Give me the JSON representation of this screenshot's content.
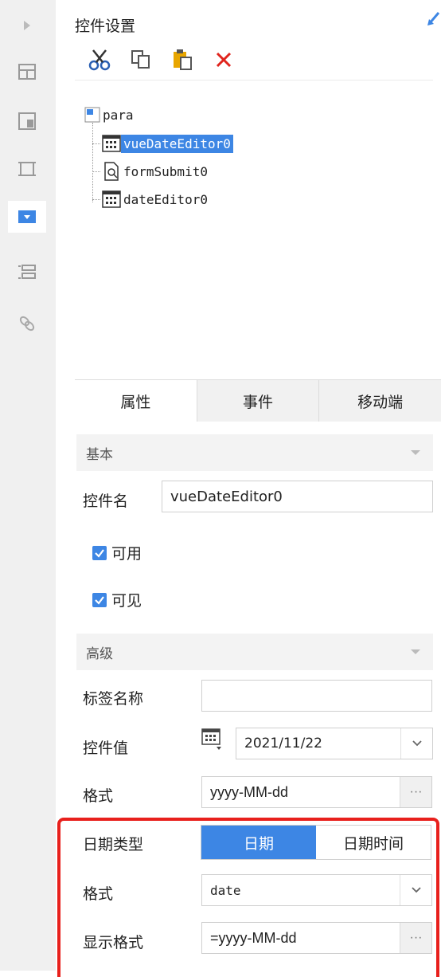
{
  "panel": {
    "title": "控件设置"
  },
  "toolbar": {
    "icons": [
      "cut-icon",
      "copy-icon",
      "paste-icon",
      "delete-icon"
    ]
  },
  "tree": {
    "root": "para",
    "children": [
      "vueDateEditor0",
      "formSubmit0",
      "dateEditor0"
    ],
    "selected": "vueDateEditor0"
  },
  "tabs": [
    "属性",
    "事件",
    "移动端"
  ],
  "basic": {
    "section": "基本",
    "name_label": "控件名",
    "name_value": "vueDateEditor0",
    "enabled_label": "可用",
    "visible_label": "可见"
  },
  "advanced": {
    "section": "高级",
    "tag_label": "标签名称",
    "tag_value": "",
    "value_label": "控件值",
    "value_value": "2021/11/22",
    "format_label": "格式",
    "format_value": "yyyy-MM-dd",
    "datetype_label": "日期类型",
    "datetype_options": [
      "日期",
      "日期时间"
    ],
    "datetype_selected": "日期",
    "format2_label": "格式",
    "format2_value": "date",
    "display_label": "显示格式",
    "display_value": "=yyyy-MM-dd",
    "dots": "···"
  },
  "colors": {
    "accent": "#3d86e4",
    "highlight_border": "#e8201c"
  }
}
